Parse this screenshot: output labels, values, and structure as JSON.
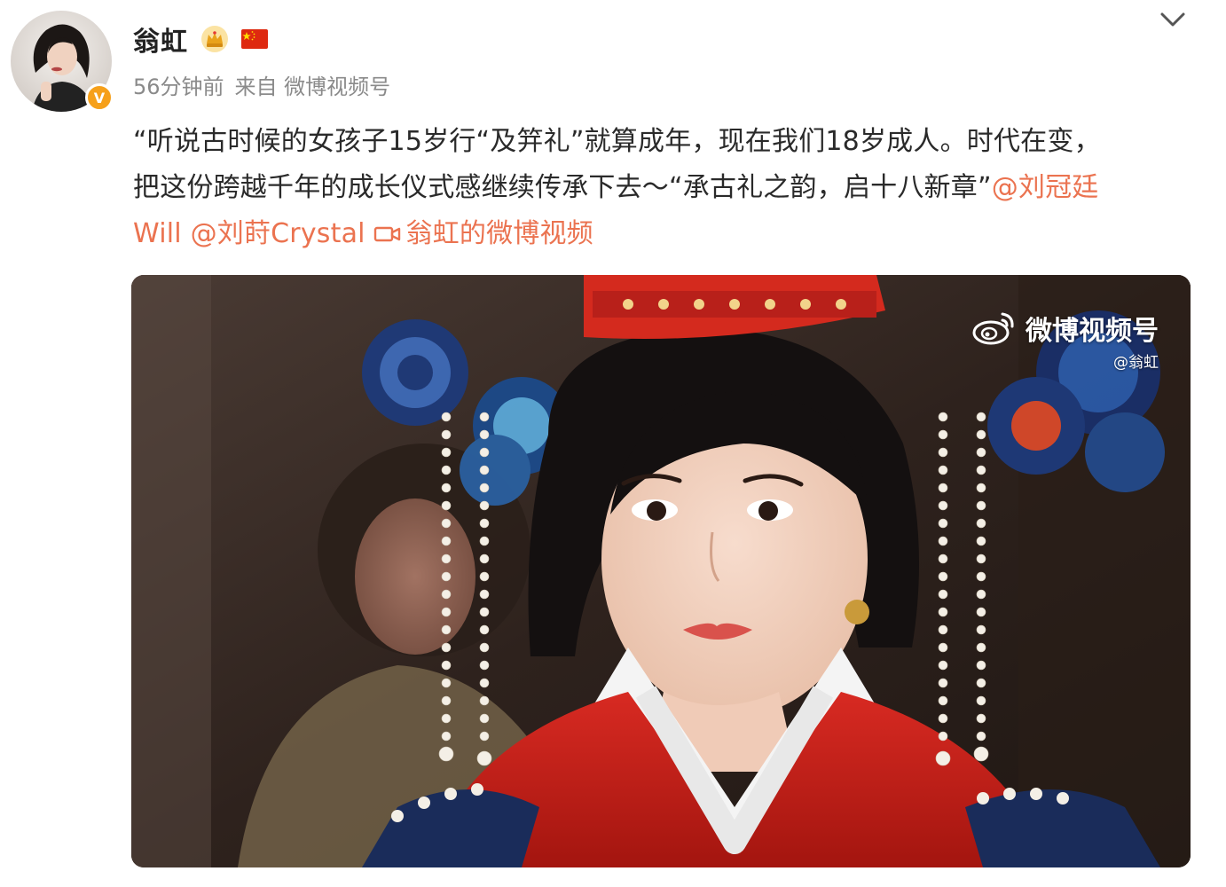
{
  "post": {
    "author": {
      "name": "翁虹",
      "verified_icon": "verified-badge-icon",
      "verified_mark": "V",
      "crown_icon": "crown-icon",
      "flag_icon": "china-flag-icon"
    },
    "meta": {
      "time": "56分钟前",
      "source": "来自 微博视频号"
    },
    "content": {
      "line1": "“听说古时候的女孩子15岁行“及笄礼”就算成年，现在我们18岁成人。时代在变，",
      "line2_text": "把这份跨越千年的成长仪式感继续传承下去～“承古礼之韵，启十八新章”",
      "line2_mention": "@刘冠廷",
      "line3_mention_cont": "Will",
      "line3_mention2": "@刘莳Crystal",
      "line3_video_link": "翁虹的微博视频"
    },
    "media": {
      "watermark_label": "微博视频号",
      "watermark_handle": "@翁虹"
    }
  },
  "colors": {
    "link": "#eb7350",
    "text": "#2a2a2a",
    "meta": "#8a8a8a",
    "verified": "#f6a01a"
  }
}
